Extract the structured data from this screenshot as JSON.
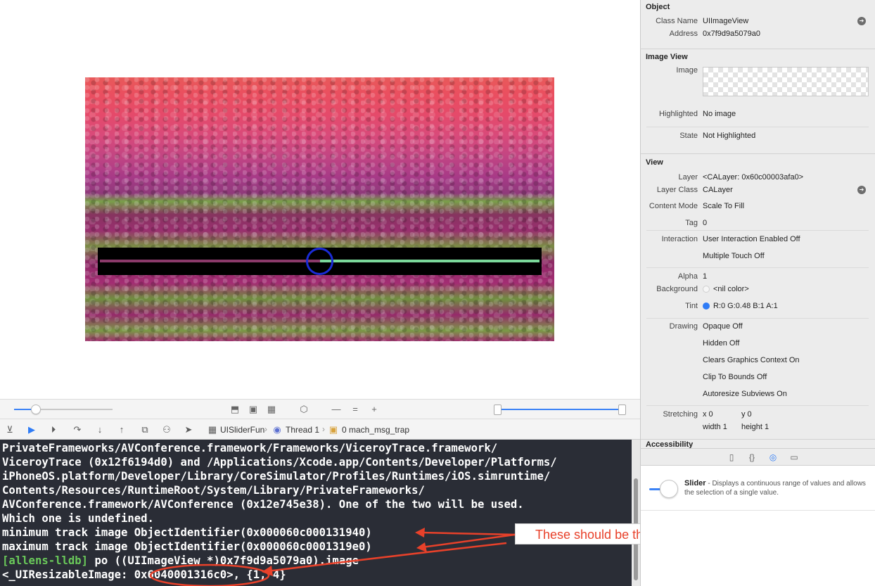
{
  "canvas": {
    "slider_value": 0.5
  },
  "debug_bar": {
    "breadcrumbs": [
      "UISliderFun",
      "Thread 1",
      "0 mach_msg_trap"
    ]
  },
  "console": {
    "lines": [
      {
        "text": "PrivateFrameworks/AVConference.framework/Frameworks/ViceroyTrace.framework/",
        "prompt": ""
      },
      {
        "text": "ViceroyTrace (0x12f6194d0) and /Applications/Xcode.app/Contents/Developer/Platforms/",
        "prompt": ""
      },
      {
        "text": "iPhoneOS.platform/Developer/Library/CoreSimulator/Profiles/Runtimes/iOS.simruntime/",
        "prompt": ""
      },
      {
        "text": "Contents/Resources/RuntimeRoot/System/Library/PrivateFrameworks/",
        "prompt": ""
      },
      {
        "text": "AVConference.framework/AVConference (0x12e745e38). One of the two will be used.",
        "prompt": ""
      },
      {
        "text": "Which one is undefined.",
        "prompt": ""
      },
      {
        "text": "minimum track image ObjectIdentifier(0x000060c000131940)",
        "prompt": ""
      },
      {
        "text": "maximum track image ObjectIdentifier(0x000060c0001319e0)",
        "prompt": ""
      },
      {
        "text": " po ((UIImageView *)0x7f9d9a5079a0).image",
        "prompt": "[allens-lldb]"
      },
      {
        "text": "<_UIResizableImage: 0x6040001316c0>, {1, 4}",
        "prompt": ""
      }
    ]
  },
  "annotation": {
    "callout_text": "These should be the same",
    "accent_color": "#e8412a"
  },
  "inspector": {
    "object": {
      "title": "Object",
      "class_name_label": "Class Name",
      "class_name_value": "UIImageView",
      "address_label": "Address",
      "address_value": "0x7f9d9a5079a0"
    },
    "image_view": {
      "title": "Image View",
      "image_label": "Image",
      "highlighted_label": "Highlighted",
      "highlighted_value": "No image",
      "state_label": "State",
      "state_value": "Not Highlighted"
    },
    "view": {
      "title": "View",
      "layer_label": "Layer",
      "layer_value": "<CALayer: 0x60c00003afa0>",
      "layer_class_label": "Layer Class",
      "layer_class_value": "CALayer",
      "content_mode_label": "Content Mode",
      "content_mode_value": "Scale To Fill",
      "tag_label": "Tag",
      "tag_value": "0",
      "interaction_label": "Interaction",
      "interaction_value_1": "User Interaction Enabled Off",
      "interaction_value_2": "Multiple Touch Off",
      "alpha_label": "Alpha",
      "alpha_value": "1",
      "background_label": "Background",
      "background_value": "<nil color>",
      "tint_label": "Tint",
      "tint_value": "R:0 G:0.48 B:1 A:1",
      "tint_color": "#2f7cf6",
      "drawing_label": "Drawing",
      "drawing_values": [
        "Opaque Off",
        "Hidden Off",
        "Clears Graphics Context On",
        "Clip To Bounds Off",
        "Autoresize Subviews On"
      ],
      "stretching_label": "Stretching",
      "stretch_x": "x  0",
      "stretch_y": "y  0",
      "stretch_w": "width  1",
      "stretch_h": "height  1",
      "accessibility_label": "Accessibility"
    }
  },
  "library": {
    "item_title": "Slider",
    "item_description": " - Displays a continuous range of values and allows the selection of a single value."
  }
}
